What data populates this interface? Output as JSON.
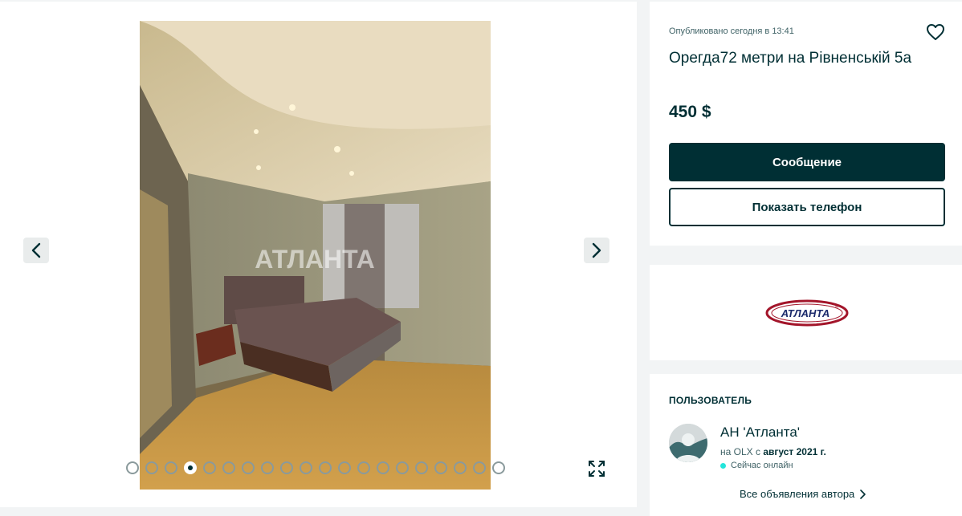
{
  "gallery": {
    "watermark": "АТЛАНТА",
    "photo_count": 20,
    "active_photo_index": 4,
    "prev_icon": "chevron-left-icon",
    "next_icon": "chevron-right-icon",
    "expand_icon": "expand-icon"
  },
  "ad": {
    "published": "Опубликовано сегодня в 13:41",
    "title": "Орегда72 метри на Рівненській 5а",
    "price": "450 $",
    "message_label": "Сообщение",
    "phone_label": "Показать телефон",
    "favorite_icon": "heart-icon"
  },
  "logo": {
    "text": "АТЛАНТА",
    "reg_mark": "®"
  },
  "user": {
    "heading": "ПОЛЬЗОВАТЕЛЬ",
    "name": "АН 'Атланта'",
    "since_prefix": "на OLX с",
    "since_date": "август 2021 г.",
    "online": "Сейчас онлайн",
    "all_ads": "Все объявления автора"
  },
  "colors": {
    "primary": "#002f34",
    "online": "#23e5db",
    "background": "#f2f4f5"
  }
}
